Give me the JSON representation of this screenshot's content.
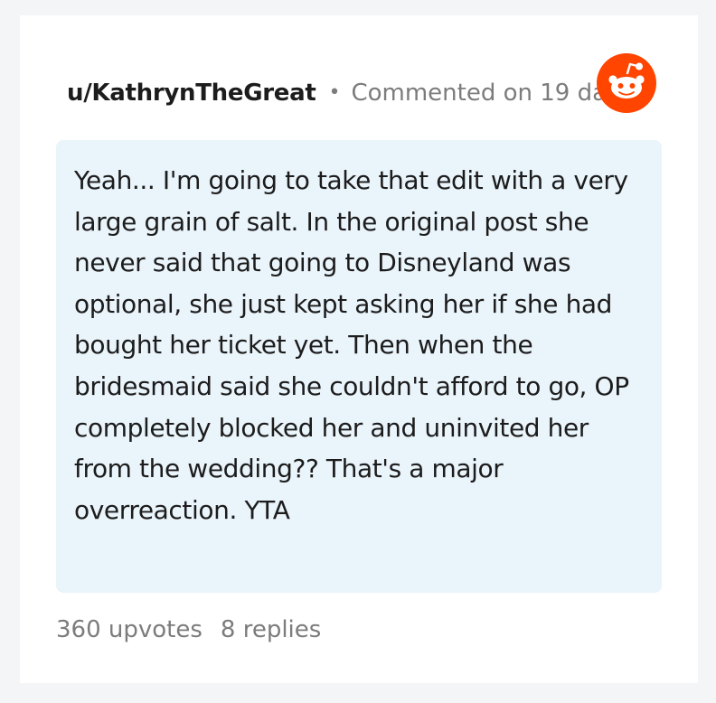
{
  "comment": {
    "username": "u/KathrynTheGreat",
    "separator": "•",
    "commented_label": "Commented on 19 days",
    "body": "Yeah... I'm going to take that edit with a very large grain of salt. In the original post she never said that going to Disneyland was optional, she just kept asking her if she had bought her ticket yet. Then when the bridesmaid said she couldn't afford to go, OP completely blocked her and uninvited her from the wedding?? That's a major overreaction. YTA",
    "upvotes": "360 upvotes",
    "replies": "8 replies"
  },
  "logo": {
    "icon": "reddit-snoo-icon",
    "color": "#ff4500"
  }
}
